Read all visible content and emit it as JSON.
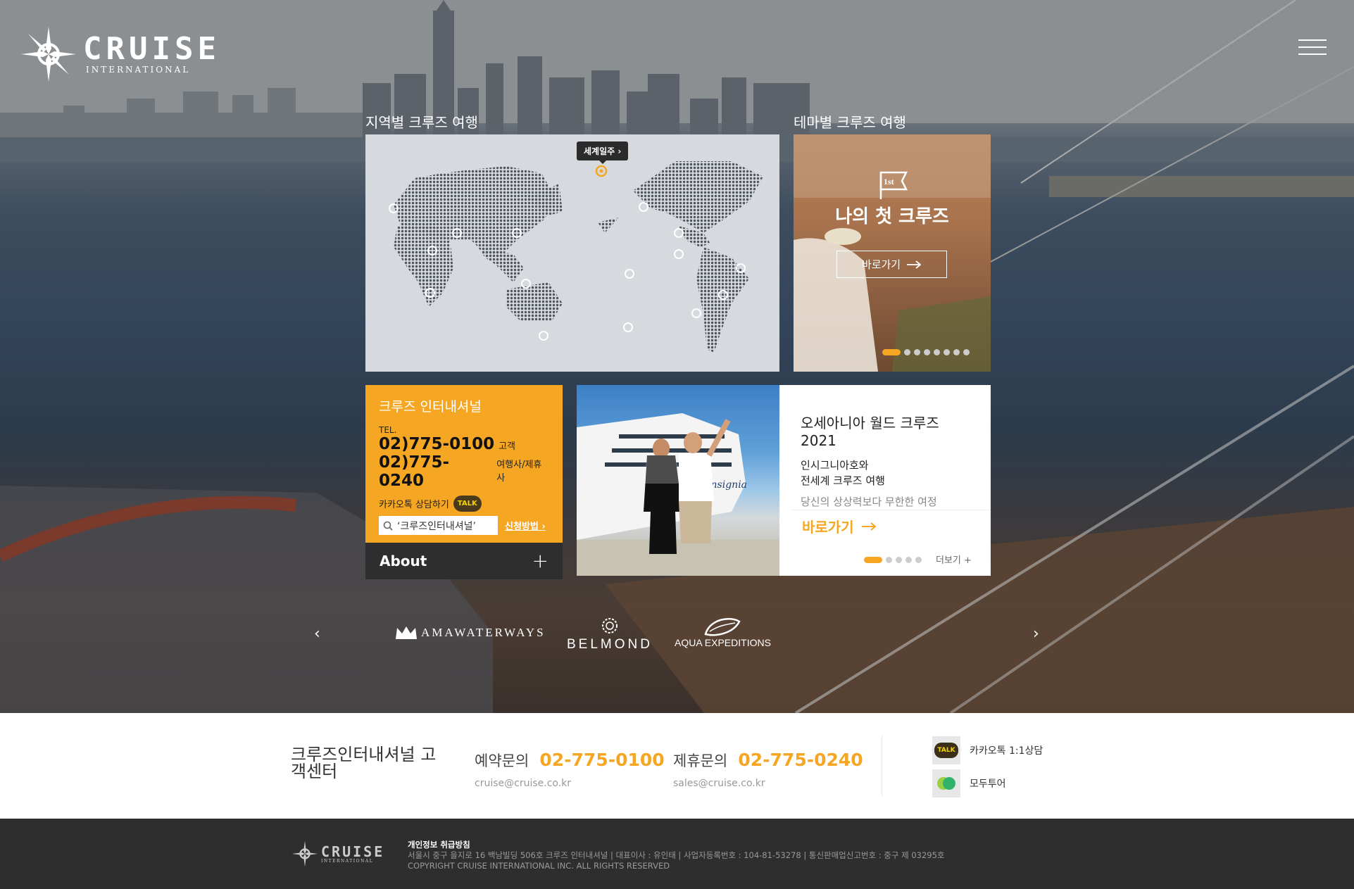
{
  "brand": {
    "name": "CRUISE",
    "tagline": "INTERNATIONAL"
  },
  "header": {
    "menu_icon": "hamburger-icon"
  },
  "regional": {
    "title": "지역별 크루즈 여행",
    "world_tag": "세계일주 ›",
    "marker_icon": "location-marker-icon"
  },
  "theme": {
    "title": "테마별 크루즈 여행",
    "card_title": "나의 첫 크루즈",
    "button_label": "바로가기",
    "icon": "first-flag-icon",
    "icon_text": "1st",
    "active_slide": 1,
    "slide_count": 8
  },
  "contact": {
    "title": "크루즈 인터내셔널",
    "tel_label": "TEL.",
    "phones": [
      {
        "number": "02)775-0100",
        "label": "고객"
      },
      {
        "number": "02)775-0240",
        "label": "여행사/제휴사"
      }
    ],
    "kakao_label": "카카오톡 상담하기",
    "talk_badge": "TALK",
    "search_text": "‘크루즈인터내셔널’",
    "howto_link": "신청방법 ›",
    "about_label": "About"
  },
  "promo": {
    "title": "오세아니아 월드 크루즈 2021",
    "desc_line1": "인시그니아호와",
    "desc_line2": "전세계 크루즈 여행",
    "sub": "당신의 상상력보다 무한한 여정",
    "button_label": "바로가기",
    "more_label": "더보기 +",
    "ship_name": "Insignia",
    "active_slide": 1,
    "slide_count": 5
  },
  "partners": {
    "items": [
      "AMAWATERWAYS",
      "BELMOND",
      "AQUA EXPEDITIONS"
    ],
    "prev_icon": "chevron-left-icon",
    "next_icon": "chevron-right-icon"
  },
  "footer_contact": {
    "title": "크루즈인터내셔널 고객센터",
    "reservation": {
      "label": "예약문의",
      "number": "02-775-0100",
      "email": "cruise@cruise.co.kr"
    },
    "partnership": {
      "label": "제휴문의",
      "number": "02-775-0240",
      "email": "sales@cruise.co.kr"
    },
    "links": [
      {
        "label": "카카오톡 1:1상담",
        "icon": "kakao-talk-icon",
        "icon_text": "TALK"
      },
      {
        "label": "모두투어",
        "icon": "modetour-icon"
      }
    ]
  },
  "footer": {
    "privacy": "개인정보 취급방침",
    "address": "서울시 중구 을지로 16 백남빌딩 506호 크루즈 인터내셔널 | 대표이사 : 유인태 | 사업자등록번호 : 104-81-53278 | 통신판매업신고번호 : 중구 제 03295호",
    "copyright": "COPYRIGHT CRUISE INTERNATIONAL INC. ALL RIGHTS RESERVED"
  }
}
